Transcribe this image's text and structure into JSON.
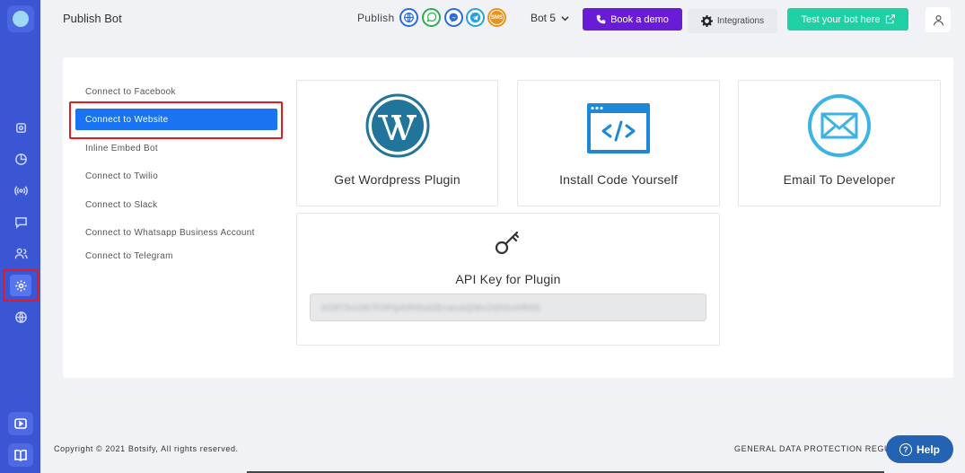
{
  "header": {
    "page_title": "Publish Bot",
    "publish_label": "Publish",
    "channels": [
      "web-icon",
      "whatsapp-icon",
      "messenger-icon",
      "telegram-icon",
      "sms-icon"
    ],
    "sms_text": "SMS",
    "bot_selector": "Bot 5",
    "book_demo_label": "Book a demo",
    "integrations_label": "Integrations",
    "test_bot_label": "Test your bot here"
  },
  "sidebar": {
    "items": [
      "settings-icon",
      "analytics-icon",
      "broadcast-icon",
      "chat-icon",
      "users-icon",
      "settings-gear-icon",
      "globe-icon"
    ],
    "active_index": 5,
    "bottom": [
      "video-icon",
      "book-icon"
    ]
  },
  "menu": {
    "items": [
      "Connect to Facebook",
      "Connect to Website",
      "Inline Embed Bot",
      "Connect to Twilio",
      "Connect to Slack",
      "Connect to Whatsapp Business Account",
      "Connect to Telegram"
    ],
    "active": "Connect to Website"
  },
  "cards": {
    "wordpress": "Get Wordpress Plugin",
    "code": "Install Code Yourself",
    "email": "Email To Developer",
    "api_title": "API Key for Plugin",
    "api_key": "XZ8TSnUN7F0PQ4tR9hd2EvwuAQWcZdX5nHR9S"
  },
  "footer": {
    "copyright": "Copyright © 2021 Botsify, All rights reserved.",
    "gdpr": "GENERAL DATA PROTECTION REGU",
    "help": "Help"
  },
  "colors": {
    "sidebar": "#3a56d4",
    "active_menu": "#1a73f0",
    "demo_button": "#6a1bd6",
    "test_button": "#1fd0a4",
    "wordpress": "#21759b",
    "code": "#1e88d8",
    "email": "#3bb4e5",
    "help": "#2462b3",
    "highlight": "#e01b24"
  }
}
